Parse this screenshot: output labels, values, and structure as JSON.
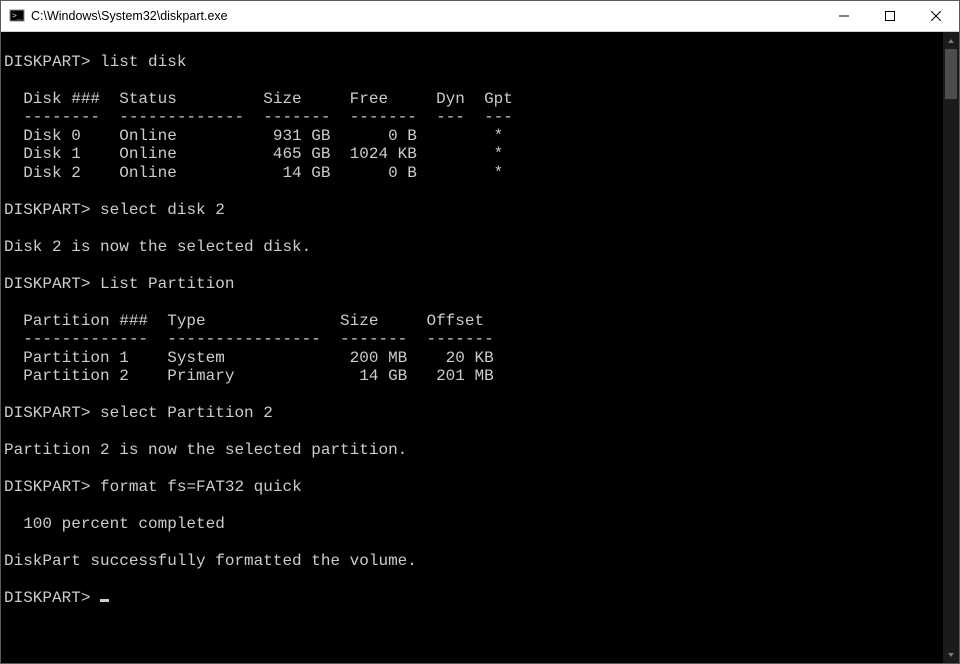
{
  "window": {
    "title": "C:\\Windows\\System32\\diskpart.exe"
  },
  "prompt": "DISKPART>",
  "session": {
    "cmd1": "list disk",
    "disk_header": "  Disk ###  Status         Size     Free     Dyn  Gpt",
    "disk_divider": "  --------  -------------  -------  -------  ---  ---",
    "disks": [
      "  Disk 0    Online          931 GB      0 B        *",
      "  Disk 1    Online          465 GB  1024 KB        *",
      "  Disk 2    Online           14 GB      0 B        *"
    ],
    "cmd2": "select disk 2",
    "resp2": "Disk 2 is now the selected disk.",
    "cmd3": "List Partition",
    "part_header": "  Partition ###  Type              Size     Offset",
    "part_divider": "  -------------  ----------------  -------  -------",
    "partitions": [
      "  Partition 1    System             200 MB    20 KB",
      "  Partition 2    Primary             14 GB   201 MB"
    ],
    "cmd4": "select Partition 2",
    "resp4": "Partition 2 is now the selected partition.",
    "cmd5": "format fs=FAT32 quick",
    "progress": "  100 percent completed",
    "resp5": "DiskPart successfully formatted the volume."
  }
}
